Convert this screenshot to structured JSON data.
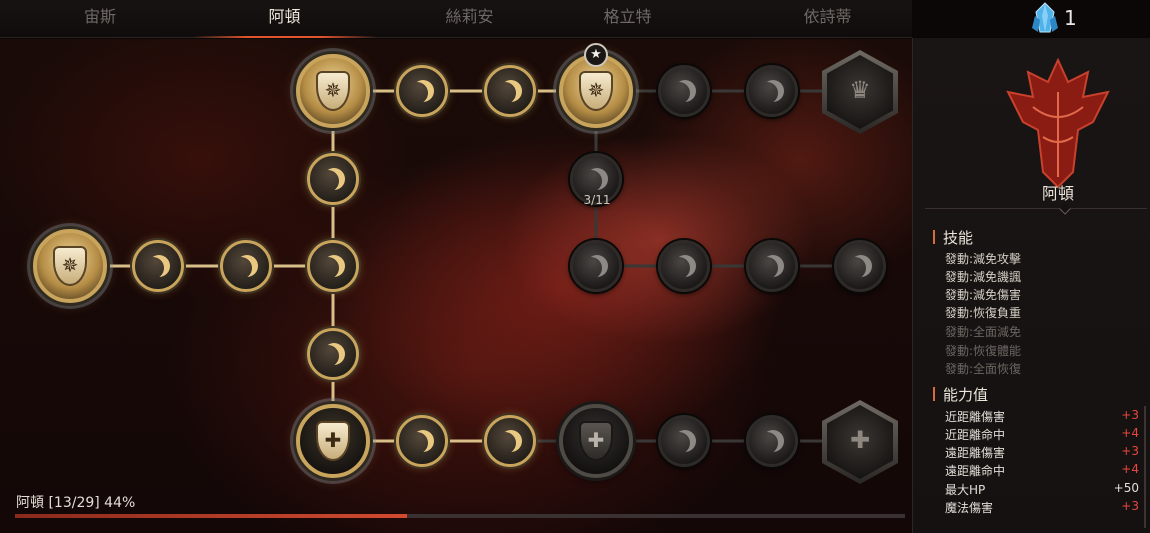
{
  "tabs": [
    {
      "label": "宙斯"
    },
    {
      "label": "阿頓"
    },
    {
      "label": "絲莉安"
    },
    {
      "label": "格立特"
    },
    {
      "label": "依詩蒂"
    }
  ],
  "active_tab": "阿頓",
  "crystal": {
    "count": "1",
    "icon": "blue-crystal-icon"
  },
  "tree": {
    "node_counter": "3/11",
    "progress_text": "阿頓 [13/29] 44%",
    "progress_percent": 44
  },
  "panel": {
    "class_name": "阿頓",
    "skills_title": "技能",
    "skills": [
      {
        "label": "發動:減免攻擊"
      },
      {
        "label": "發動:減免譏諷"
      },
      {
        "label": "發動:減免傷害"
      },
      {
        "label": "發動:恢復負重"
      },
      {
        "label": "發動:全面減免"
      },
      {
        "label": "發動:恢復體能"
      },
      {
        "label": "發動:全面恢復"
      }
    ],
    "stats_title": "能力值",
    "stats": [
      {
        "label": "近距離傷害",
        "value": "+3"
      },
      {
        "label": "近距離命中",
        "value": "+4"
      },
      {
        "label": "遠距離傷害",
        "value": "+3"
      },
      {
        "label": "遠距離命中",
        "value": "+4"
      },
      {
        "label": "最大HP",
        "value": "+50"
      },
      {
        "label": "魔法傷害",
        "value": "+3"
      }
    ]
  },
  "colors": {
    "accent": "#e0552e",
    "gold": "#c9a45c",
    "stat_red": "#e8473e"
  }
}
